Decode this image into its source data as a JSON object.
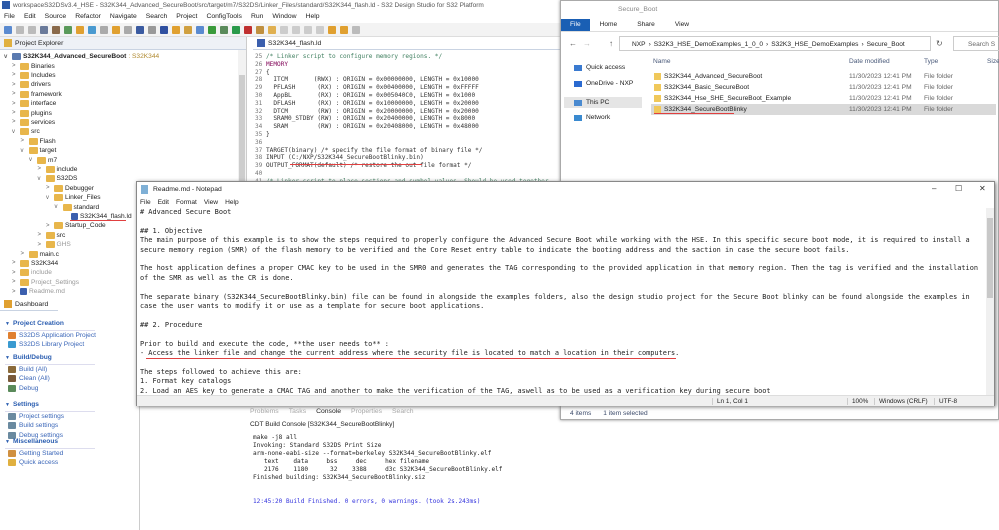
{
  "ide": {
    "title": "workspaceS32DSv3.4_HSE - S32K344_Advanced_SecureBoot/src/target/m7/S32DS/Linker_Files/standard/S32K344_flash.ld - S32 Design Studio for S32 Platform",
    "menu": [
      "File",
      "Edit",
      "Source",
      "Refactor",
      "Navigate",
      "Search",
      "Project",
      "ConfigTools",
      "Run",
      "Window",
      "Help"
    ]
  },
  "project_explorer": {
    "tab_label": "Project Explorer",
    "root": "S32K344_Advanced_SecureBoot",
    "root_suffix": ": S32K344",
    "items": [
      {
        "label": "Binaries",
        "depth": 1,
        "state": "collapsed",
        "dim": false
      },
      {
        "label": "Includes",
        "depth": 1,
        "state": "collapsed",
        "dim": false
      },
      {
        "label": "drivers",
        "depth": 1,
        "state": "collapsed",
        "dim": false
      },
      {
        "label": "framework",
        "depth": 1,
        "state": "collapsed",
        "dim": false
      },
      {
        "label": "interface",
        "depth": 1,
        "state": "collapsed",
        "dim": false
      },
      {
        "label": "plugins",
        "depth": 1,
        "state": "collapsed",
        "dim": false
      },
      {
        "label": "services",
        "depth": 1,
        "state": "collapsed",
        "dim": false
      },
      {
        "label": "src",
        "depth": 1,
        "state": "expanded",
        "dim": false
      },
      {
        "label": "Flash",
        "depth": 2,
        "state": "collapsed",
        "dim": false
      },
      {
        "label": "target",
        "depth": 2,
        "state": "expanded",
        "dim": false
      },
      {
        "label": "m7",
        "depth": 3,
        "state": "expanded",
        "dim": false
      },
      {
        "label": "include",
        "depth": 4,
        "state": "collapsed",
        "dim": false
      },
      {
        "label": "S32DS",
        "depth": 4,
        "state": "expanded",
        "dim": false
      },
      {
        "label": "Debugger",
        "depth": 5,
        "state": "collapsed",
        "dim": false
      },
      {
        "label": "Linker_Files",
        "depth": 5,
        "state": "expanded",
        "dim": false
      },
      {
        "label": "standard",
        "depth": 6,
        "state": "expanded",
        "dim": false
      },
      {
        "label": "S32K344_flash.ld",
        "depth": 7,
        "state": "file",
        "dim": false
      },
      {
        "label": "Startup_Code",
        "depth": 5,
        "state": "collapsed",
        "dim": false
      },
      {
        "label": "src",
        "depth": 4,
        "state": "collapsed",
        "dim": false
      },
      {
        "label": "GHS",
        "depth": 4,
        "state": "collapsed",
        "dim": true
      },
      {
        "label": "main.c",
        "depth": 2,
        "state": "collapsed",
        "dim": false
      },
      {
        "label": "S32K344",
        "depth": 1,
        "state": "collapsed",
        "dim": false
      },
      {
        "label": "include",
        "depth": 1,
        "state": "collapsed",
        "dim": true
      },
      {
        "label": "Project_Settings",
        "depth": 1,
        "state": "collapsed",
        "dim": true
      },
      {
        "label": "Readme.md",
        "depth": 1,
        "state": "file",
        "dim": true
      }
    ]
  },
  "editor": {
    "tab_label": "S32K344_flash.ld",
    "lines": [
      {
        "n": "25",
        "text": "/* Linker script to configure memory regions. */"
      },
      {
        "n": "26",
        "text": "MEMORY"
      },
      {
        "n": "27",
        "text": "{"
      },
      {
        "n": "28",
        "text": "  ITCM       (RWX) : ORIGIN = 0x00000000, LENGTH = 0x10000"
      },
      {
        "n": "29",
        "text": "  PFLASH      (RX) : ORIGIN = 0x00400000, LENGTH = 0xFFFFF"
      },
      {
        "n": "30",
        "text": "  AppBL       (RX) : ORIGIN = 0x005040C0, LENGTH = 0x1000"
      },
      {
        "n": "31",
        "text": "  DFLASH      (RX) : ORIGIN = 0x10000000, LENGTH = 0x20000"
      },
      {
        "n": "32",
        "text": "  DTCM        (RW) : ORIGIN = 0x20000000, LENGTH = 0x20000"
      },
      {
        "n": "33",
        "text": "  SRAM0_STDBY (RW) : ORIGIN = 0x20400000, LENGTH = 0x8000"
      },
      {
        "n": "34",
        "text": "  SRAM        (RW) : ORIGIN = 0x20408000, LENGTH = 0x48000"
      },
      {
        "n": "35",
        "text": "}"
      },
      {
        "n": "36",
        "text": ""
      },
      {
        "n": "37",
        "text": "TARGET(binary) /* specify the file format of binary file */"
      },
      {
        "n": "38",
        "text": "INPUT (C:/NXP/S32K344_SecureBootBlinky.bin)"
      },
      {
        "n": "39",
        "text": "OUTPUT_FORMAT(default) /* restore the out file format */"
      },
      {
        "n": "40",
        "text": ""
      },
      {
        "n": "41",
        "text": "/* Linker script to place sections and symbol values. Should be used together"
      }
    ]
  },
  "dashboard": {
    "tab_label": "Dashboard",
    "sections": [
      {
        "title": "Project Creation",
        "items": [
          "S32DS Application Project",
          "S32DS Library Project"
        ]
      },
      {
        "title": "Build/Debug",
        "items": [
          "Build   (All)",
          "Clean   (All)",
          "Debug"
        ]
      },
      {
        "title": "Settings",
        "items": [
          "Project settings",
          "Build settings",
          "Debug settings"
        ]
      },
      {
        "title": "Miscellaneous",
        "items": [
          "Getting Started",
          "Quick access"
        ]
      }
    ]
  },
  "file_explorer": {
    "title": "Secure_Boot",
    "ribbon": [
      "File",
      "Home",
      "Share",
      "View"
    ],
    "path": [
      "NXP",
      "S32K3_HSE_DemoExamples_1_0_0",
      "S32K3_HSE_DemoExamples",
      "Secure_Boot"
    ],
    "search_placeholder": "Search S",
    "nav": [
      "Quick access",
      "OneDrive - NXP",
      "This PC",
      "Network"
    ],
    "columns": [
      "Name",
      "Date modified",
      "Type",
      "Size"
    ],
    "rows": [
      {
        "name": "S32K344_Advanced_SecureBoot",
        "date": "11/30/2023 12:41 PM",
        "type": "File folder"
      },
      {
        "name": "S32K344_Basic_SecureBoot",
        "date": "11/30/2023 12:41 PM",
        "type": "File folder"
      },
      {
        "name": "S32K344_Hse_SHE_SecureBoot_Example",
        "date": "11/30/2023 12:41 PM",
        "type": "File folder"
      },
      {
        "name": "S32K344_SecureBootBlinky",
        "date": "11/30/2023 12:41 PM",
        "type": "File folder"
      }
    ],
    "status_count": "4 items",
    "status_selected": "1 item selected"
  },
  "notepad": {
    "title": "Readme.md - Notepad",
    "menu": [
      "File",
      "Edit",
      "Format",
      "View",
      "Help"
    ],
    "lines": [
      "# Advanced Secure Boot",
      "",
      "## 1. Objective",
      "The main purpose of this example is to show the steps required to properly configure the Advanced Secure Boot while working with the HSE. In this specific secure boot mode, it is required to install a",
      "secure memory region (SMR) of the flash memory to be verified and the Core Reset entry table to indicate the booting address and the saction in case the secure boot fails.",
      "",
      "The host application defines a proper CMAC key to be used in the SMR0 and generates the TAG corresponding to the provided application in that memory region. Then the tag is verified and the installation",
      "of the SMR as well as the CR is done.",
      "",
      "The separate binary (S32K344_SecureBootBlinky.bin) file can be found in alongside the examples folders, also the design studio project for the Secure Boot blinky can be found alongside the examples in",
      "case the user wants to modify it or use as a template for secure boot applications.",
      "",
      "## 2. Procedure",
      "",
      "Prior to build and execute the code, **the user needs to** :",
      "- Access the linker file and change the current address where the security file is located to match a location in their computers.",
      "",
      "The steps followed to achieve this are:",
      "1. Format key catalogs",
      "2. Load an AES key to generate a CMAC TAG and another to make the verification of the TAG, aswell as to be used as a verification key during secure boot"
    ],
    "status": {
      "position": "Ln 1, Col 1",
      "zoom": "100%",
      "line_ending": "Windows (CRLF)",
      "encoding": "UTF-8"
    }
  },
  "console": {
    "tabs": [
      "Problems",
      "Tasks",
      "Console",
      "Properties",
      "Search"
    ],
    "active_tab": "Console",
    "label": "CDT Build Console [S32K344_SecureBootBlinky]",
    "lines": [
      "make -j8 all",
      "Invoking: Standard S32DS Print Size",
      "arm-none-eabi-size --format=berkeley S32K344_SecureBootBlinky.elf",
      "   text    data     bss     dec     hex filename",
      "   2176    1180      32    3388     d3c S32K344_SecureBootBlinky.elf",
      "Finished building: S32K344_SecureBootBlinky.siz"
    ],
    "result": "12:45:20 Build Finished. 0 errors, 0 warnings. (took 2s.243ms)"
  }
}
